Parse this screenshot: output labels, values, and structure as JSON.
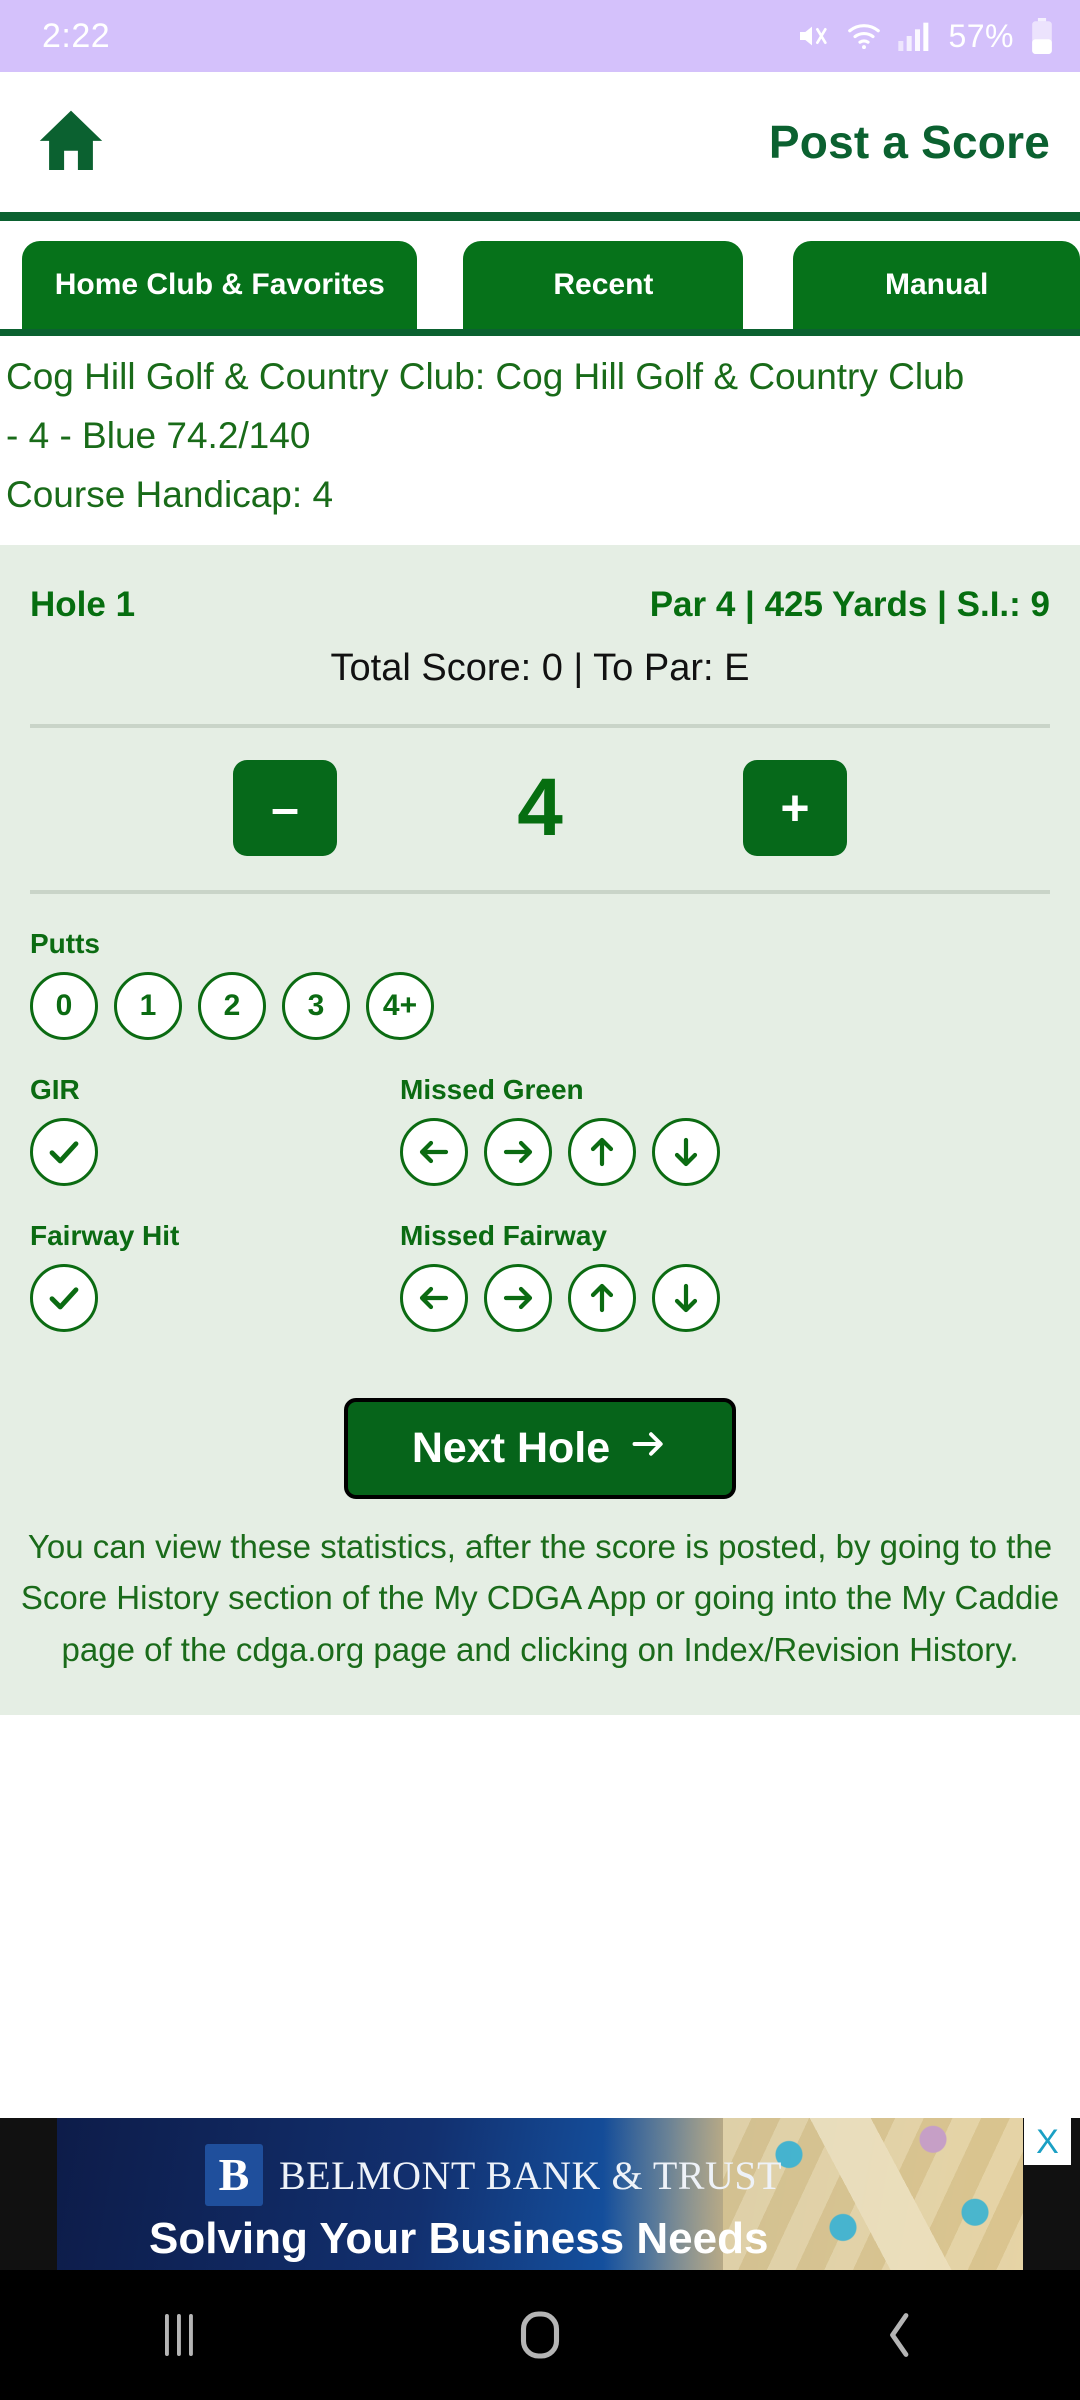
{
  "status_bar": {
    "time": "2:22",
    "battery_percent": "57%",
    "icons": [
      "mute-icon",
      "wifi-icon",
      "cellular-signal-icon",
      "battery-icon"
    ]
  },
  "header": {
    "home_icon": "home-icon",
    "title": "Post a Score"
  },
  "tabs": [
    {
      "label": "Home Club & Favorites",
      "selected": true
    },
    {
      "label": "Recent",
      "selected": false
    },
    {
      "label": "Manual",
      "selected": false
    }
  ],
  "course": {
    "line1": "Cog Hill Golf & Country Club: Cog Hill Golf & Country Club",
    "line2": "- 4 - Blue 74.2/140",
    "line3": "Course Handicap: 4"
  },
  "scorecard": {
    "hole_label": "Hole 1",
    "hole_meta": "Par 4 | 425 Yards | S.I.: 9",
    "totals": "Total Score: 0 | To Par: E",
    "minus_label": "–",
    "plus_label": "+",
    "score_value": "4",
    "putts": {
      "label": "Putts",
      "options": [
        "0",
        "1",
        "2",
        "3",
        "4+"
      ]
    },
    "gir": {
      "label": "GIR",
      "icon": "check-icon"
    },
    "missed_green": {
      "label": "Missed Green",
      "options": [
        "arrow-left-icon",
        "arrow-right-icon",
        "arrow-up-icon",
        "arrow-down-icon"
      ]
    },
    "fairway_hit": {
      "label": "Fairway Hit",
      "icon": "check-icon"
    },
    "missed_fairway": {
      "label": "Missed Fairway",
      "options": [
        "arrow-left-icon",
        "arrow-right-icon",
        "arrow-up-icon",
        "arrow-down-icon"
      ]
    },
    "next_button": "Next Hole",
    "info_text": "You can view these statistics, after the score is posted, by going to the Score History section of the My CDGA App or going into the My Caddie page of the cdga.org page and clicking on Index/Revision History."
  },
  "ad": {
    "logo_letter": "B",
    "brand": "BELMONT BANK & TRUST",
    "tagline": "Solving Your Business Needs",
    "close_label": "X"
  },
  "nav_bar": {
    "recents": "recents-icon",
    "home": "home-square-icon",
    "back": "back-chevron-icon"
  },
  "colors": {
    "status_bar_bg": "#d4c1fb",
    "brand_green": "#0b6130",
    "tab_green": "#06721a",
    "card_bg": "#e5eee4",
    "text_green": "#196b19",
    "ad_blue": "#12306f"
  }
}
